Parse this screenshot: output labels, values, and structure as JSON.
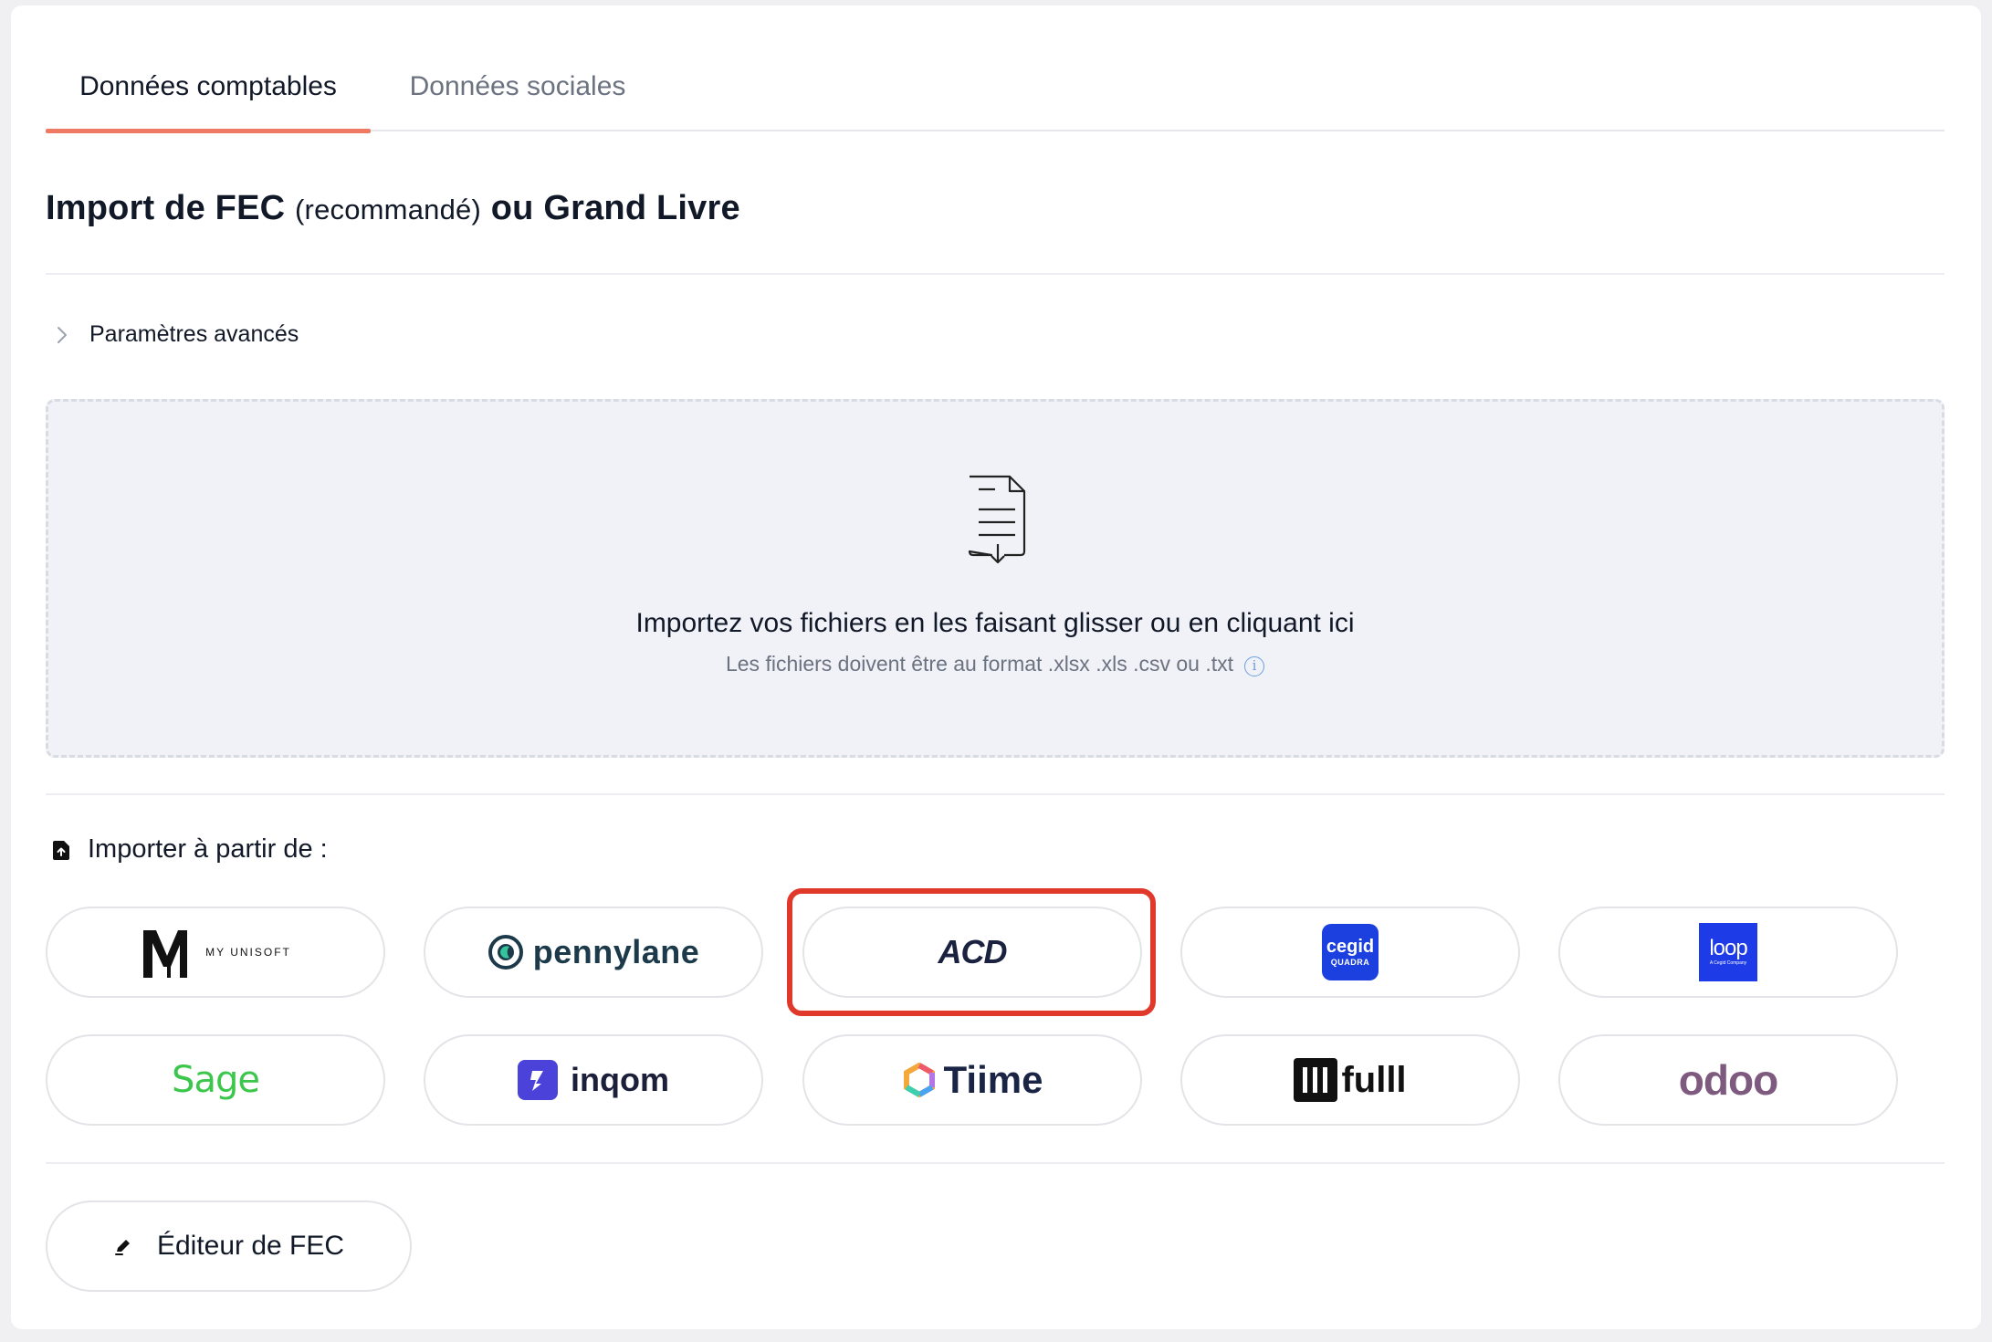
{
  "tabs": [
    {
      "label": "Données comptables",
      "active": true
    },
    {
      "label": "Données sociales",
      "active": false
    }
  ],
  "section": {
    "title_part1": "Import de FEC ",
    "title_paren": "(recommandé)",
    "title_part2": " ou Grand Livre"
  },
  "advanced": {
    "label": "Paramètres avancés"
  },
  "dropzone": {
    "title": "Importez vos fichiers en les faisant glisser ou en cliquant ici",
    "subtitle": "Les fichiers doivent être au format .xlsx .xls .csv ou .txt",
    "info_glyph": "i"
  },
  "import_from": {
    "label": "Importer à partir de :"
  },
  "providers": [
    {
      "id": "myunisoft",
      "logo_text": "M",
      "caption": "MY UNISOFT"
    },
    {
      "id": "pennylane",
      "logo_text": "pennylane"
    },
    {
      "id": "acd",
      "logo_text": "ACD",
      "highlighted": true
    },
    {
      "id": "cegid",
      "logo_text": "cegid",
      "caption": "QUADRA"
    },
    {
      "id": "loop",
      "logo_text": "loop",
      "caption": "A Cegid Company"
    },
    {
      "id": "sage",
      "logo_text": "Sage"
    },
    {
      "id": "inqom",
      "logo_text": "inqom"
    },
    {
      "id": "tiime",
      "logo_text": "Tiime"
    },
    {
      "id": "fulll",
      "logo_text": "fulll"
    },
    {
      "id": "odoo",
      "logo_text": "odoo"
    }
  ],
  "editor": {
    "label": "Éditeur de FEC"
  },
  "colors": {
    "accent_tab": "#ee7a63",
    "highlight": "#e0392b",
    "pennylane": "#1c3a4a",
    "acd": "#1b2240",
    "cegid": "#1c3fe0",
    "loop": "#1e3be8",
    "sage": "#3dc64c",
    "inqom": "#4a42d9",
    "tiime": "#1a2444",
    "odoo": "#7d5a7e"
  }
}
